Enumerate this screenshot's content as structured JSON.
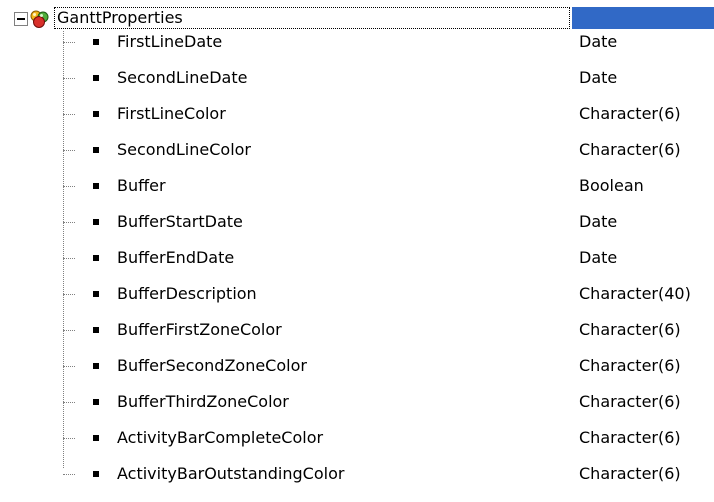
{
  "root": {
    "label": "GanttProperties",
    "icon": "sdt-structure-icon",
    "expanded": true,
    "selection_color": "#3169c6"
  },
  "properties": [
    {
      "name": "FirstLineDate",
      "type": "Date"
    },
    {
      "name": "SecondLineDate",
      "type": "Date"
    },
    {
      "name": "FirstLineColor",
      "type": "Character(6)"
    },
    {
      "name": "SecondLineColor",
      "type": "Character(6)"
    },
    {
      "name": "Buffer",
      "type": "Boolean"
    },
    {
      "name": "BufferStartDate",
      "type": "Date"
    },
    {
      "name": "BufferEndDate",
      "type": "Date"
    },
    {
      "name": "BufferDescription",
      "type": "Character(40)"
    },
    {
      "name": "BufferFirstZoneColor",
      "type": "Character(6)"
    },
    {
      "name": "BufferSecondZoneColor",
      "type": "Character(6)"
    },
    {
      "name": "BufferThirdZoneColor",
      "type": "Character(6)"
    },
    {
      "name": "ActivityBarCompleteColor",
      "type": "Character(6)"
    },
    {
      "name": "ActivityBarOutstandingColor",
      "type": "Character(6)"
    }
  ]
}
